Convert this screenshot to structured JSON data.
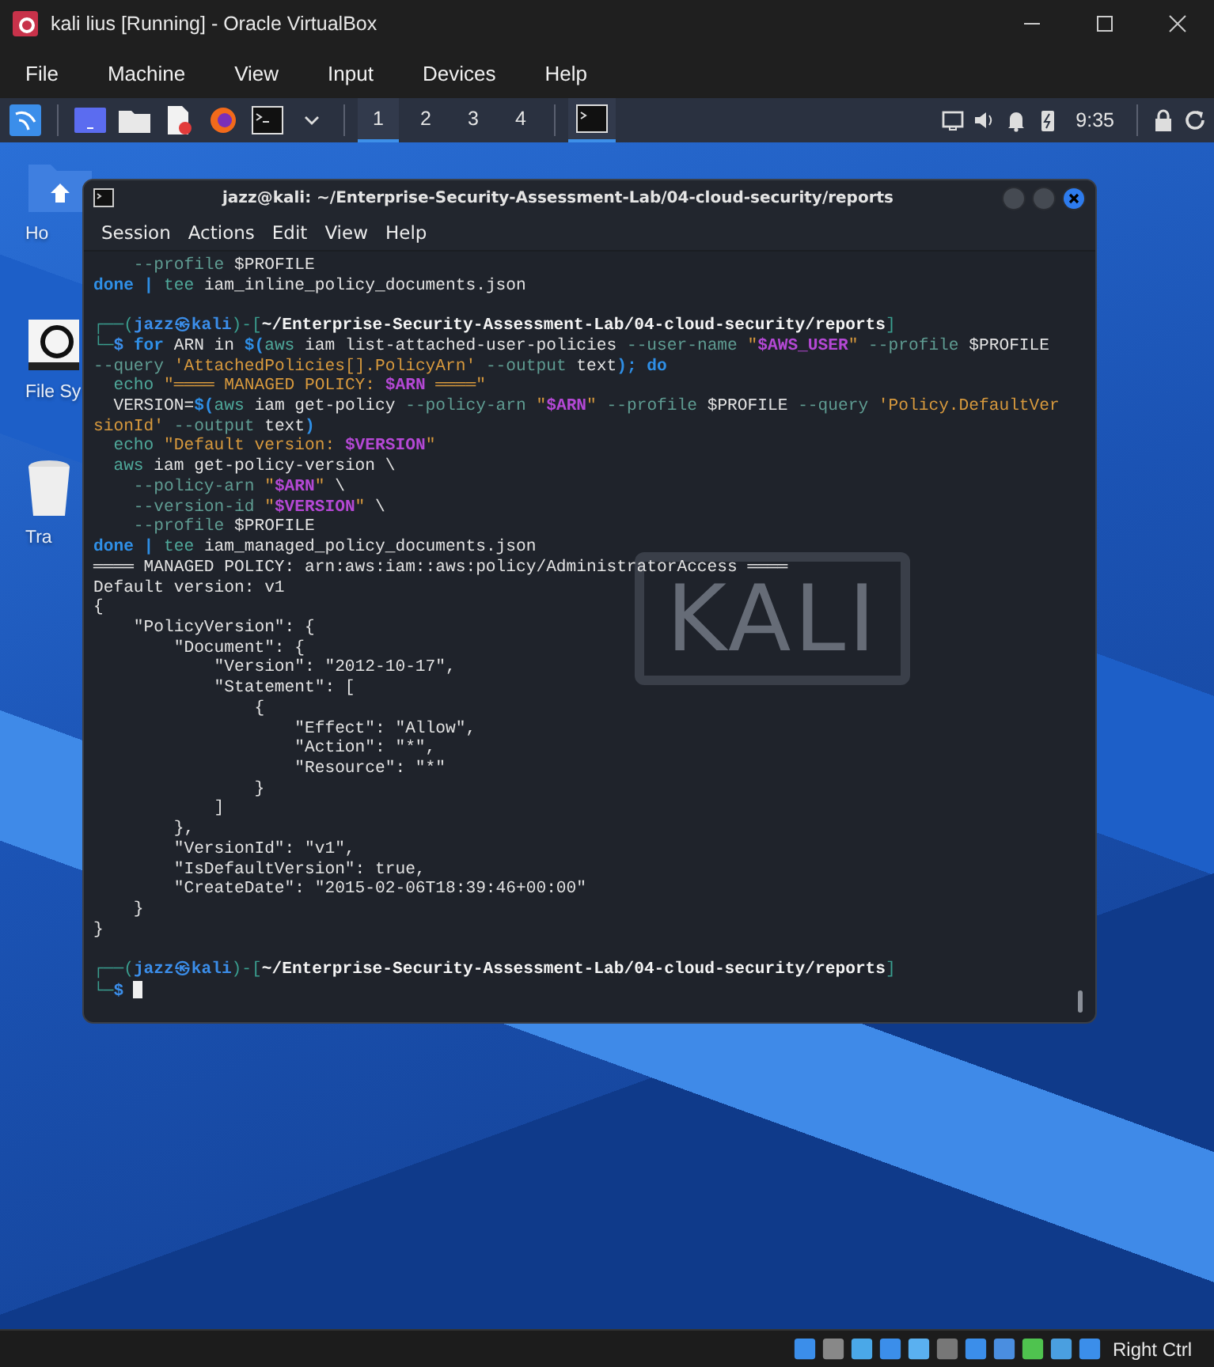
{
  "vm_window": {
    "title": "kali lius [Running] - Oracle VirtualBox",
    "menu": [
      "File",
      "Machine",
      "View",
      "Input",
      "Devices",
      "Help"
    ]
  },
  "panel": {
    "workspaces": [
      {
        "label": "1",
        "selected": true
      },
      {
        "label": "2",
        "selected": false
      },
      {
        "label": "3",
        "selected": false
      },
      {
        "label": "4",
        "selected": false
      }
    ],
    "clock": "9:35"
  },
  "desktop_icons": [
    {
      "label": "Ho",
      "kind": "home"
    },
    {
      "label": "File Sy",
      "kind": "drive"
    },
    {
      "label": "Tra",
      "kind": "trash"
    }
  ],
  "terminal": {
    "title": "jazz@kali: ~/Enterprise-Security-Assessment-Lab/04-cloud-security/reports",
    "menu": [
      "Session",
      "Actions",
      "Edit",
      "View",
      "Help"
    ],
    "background_logo": "KALI",
    "lines": [
      {
        "kind": "text",
        "segments": [
          {
            "text": "    --profile",
            "kind": "opt"
          },
          {
            "text": " $PROFILE",
            "kind": "plain"
          }
        ]
      },
      {
        "kind": "text",
        "segments": [
          {
            "text": "done | ",
            "kind": "kw"
          },
          {
            "text": "tee",
            "kind": "cmd"
          },
          {
            "text": " iam_inline_policy_documents.json",
            "kind": "plain"
          }
        ]
      },
      {
        "kind": "blank"
      },
      {
        "kind": "text",
        "segments": [
          {
            "text": "┌──(",
            "kind": "frame"
          },
          {
            "text": "jazz㉿kali",
            "kind": "user"
          },
          {
            "text": ")-[",
            "kind": "frame"
          },
          {
            "text": "~/Enterprise-Security-Assessment-Lab/04-cloud-security/reports",
            "kind": "path"
          },
          {
            "text": "]",
            "kind": "frame"
          }
        ]
      },
      {
        "kind": "text",
        "segments": [
          {
            "text": "└─",
            "kind": "frame"
          },
          {
            "text": "$ ",
            "kind": "user"
          },
          {
            "text": "for",
            "kind": "kw"
          },
          {
            "text": " ARN in ",
            "kind": "plain"
          },
          {
            "text": "$(",
            "kind": "kw"
          },
          {
            "text": "aws",
            "kind": "cmd"
          },
          {
            "text": " iam list-attached-user-policies ",
            "kind": "plain"
          },
          {
            "text": "--user-name",
            "kind": "opt"
          },
          {
            "text": " \"",
            "kind": "str"
          },
          {
            "text": "$AWS_USER",
            "kind": "var"
          },
          {
            "text": "\"",
            "kind": "str"
          },
          {
            "text": " --profile",
            "kind": "opt"
          },
          {
            "text": " $PROFILE",
            "kind": "plain"
          }
        ]
      },
      {
        "kind": "text",
        "segments": [
          {
            "text": "--query",
            "kind": "opt"
          },
          {
            "text": " 'AttachedPolicies[].PolicyArn'",
            "kind": "str"
          },
          {
            "text": " --output",
            "kind": "opt"
          },
          {
            "text": " text",
            "kind": "plain"
          },
          {
            "text": "); do",
            "kind": "kw"
          }
        ]
      },
      {
        "kind": "text",
        "segments": [
          {
            "text": "  echo",
            "kind": "cmd"
          },
          {
            "text": " \"════ MANAGED POLICY: ",
            "kind": "str"
          },
          {
            "text": "$ARN",
            "kind": "var"
          },
          {
            "text": " ════\"",
            "kind": "str"
          }
        ]
      },
      {
        "kind": "text",
        "segments": [
          {
            "text": "  VERSION=",
            "kind": "plain"
          },
          {
            "text": "$(",
            "kind": "kw"
          },
          {
            "text": "aws",
            "kind": "cmd"
          },
          {
            "text": " iam get-policy ",
            "kind": "plain"
          },
          {
            "text": "--policy-arn",
            "kind": "opt"
          },
          {
            "text": " \"",
            "kind": "str"
          },
          {
            "text": "$ARN",
            "kind": "var"
          },
          {
            "text": "\"",
            "kind": "str"
          },
          {
            "text": " --profile",
            "kind": "opt"
          },
          {
            "text": " $PROFILE ",
            "kind": "plain"
          },
          {
            "text": "--query",
            "kind": "opt"
          },
          {
            "text": " 'Policy.DefaultVer",
            "kind": "str"
          }
        ]
      },
      {
        "kind": "text",
        "segments": [
          {
            "text": "sionId'",
            "kind": "str"
          },
          {
            "text": " --output",
            "kind": "opt"
          },
          {
            "text": " text",
            "kind": "plain"
          },
          {
            "text": ")",
            "kind": "kw"
          }
        ]
      },
      {
        "kind": "text",
        "segments": [
          {
            "text": "  echo",
            "kind": "cmd"
          },
          {
            "text": " \"Default version: ",
            "kind": "str"
          },
          {
            "text": "$VERSION",
            "kind": "var"
          },
          {
            "text": "\"",
            "kind": "str"
          }
        ]
      },
      {
        "kind": "text",
        "segments": [
          {
            "text": "  aws",
            "kind": "cmd"
          },
          {
            "text": " iam get-policy-version \\",
            "kind": "plain"
          }
        ]
      },
      {
        "kind": "text",
        "segments": [
          {
            "text": "    --policy-arn",
            "kind": "opt"
          },
          {
            "text": " \"",
            "kind": "str"
          },
          {
            "text": "$ARN",
            "kind": "var"
          },
          {
            "text": "\"",
            "kind": "str"
          },
          {
            "text": " \\",
            "kind": "plain"
          }
        ]
      },
      {
        "kind": "text",
        "segments": [
          {
            "text": "    --version-id",
            "kind": "opt"
          },
          {
            "text": " \"",
            "kind": "str"
          },
          {
            "text": "$VERSION",
            "kind": "var"
          },
          {
            "text": "\"",
            "kind": "str"
          },
          {
            "text": " \\",
            "kind": "plain"
          }
        ]
      },
      {
        "kind": "text",
        "segments": [
          {
            "text": "    --profile",
            "kind": "opt"
          },
          {
            "text": " $PROFILE",
            "kind": "plain"
          }
        ]
      },
      {
        "kind": "text",
        "segments": [
          {
            "text": "done | ",
            "kind": "kw"
          },
          {
            "text": "tee",
            "kind": "cmd"
          },
          {
            "text": " iam_managed_policy_documents.json",
            "kind": "plain"
          }
        ]
      },
      {
        "kind": "text",
        "segments": [
          {
            "text": "════ MANAGED POLICY: arn:aws:iam::aws:policy/AdministratorAccess ════",
            "kind": "plain"
          }
        ]
      },
      {
        "kind": "text",
        "segments": [
          {
            "text": "Default version: v1",
            "kind": "plain"
          }
        ]
      },
      {
        "kind": "text",
        "segments": [
          {
            "text": "{",
            "kind": "plain"
          }
        ]
      },
      {
        "kind": "text",
        "segments": [
          {
            "text": "    \"PolicyVersion\": {",
            "kind": "plain"
          }
        ]
      },
      {
        "kind": "text",
        "segments": [
          {
            "text": "        \"Document\": {",
            "kind": "plain"
          }
        ]
      },
      {
        "kind": "text",
        "segments": [
          {
            "text": "            \"Version\": \"2012-10-17\",",
            "kind": "plain"
          }
        ]
      },
      {
        "kind": "text",
        "segments": [
          {
            "text": "            \"Statement\": [",
            "kind": "plain"
          }
        ]
      },
      {
        "kind": "text",
        "segments": [
          {
            "text": "                {",
            "kind": "plain"
          }
        ]
      },
      {
        "kind": "text",
        "segments": [
          {
            "text": "                    \"Effect\": \"Allow\",",
            "kind": "plain"
          }
        ]
      },
      {
        "kind": "text",
        "segments": [
          {
            "text": "                    \"Action\": \"*\",",
            "kind": "plain"
          }
        ]
      },
      {
        "kind": "text",
        "segments": [
          {
            "text": "                    \"Resource\": \"*\"",
            "kind": "plain"
          }
        ]
      },
      {
        "kind": "text",
        "segments": [
          {
            "text": "                }",
            "kind": "plain"
          }
        ]
      },
      {
        "kind": "text",
        "segments": [
          {
            "text": "            ]",
            "kind": "plain"
          }
        ]
      },
      {
        "kind": "text",
        "segments": [
          {
            "text": "        },",
            "kind": "plain"
          }
        ]
      },
      {
        "kind": "text",
        "segments": [
          {
            "text": "        \"VersionId\": \"v1\",",
            "kind": "plain"
          }
        ]
      },
      {
        "kind": "text",
        "segments": [
          {
            "text": "        \"IsDefaultVersion\": true,",
            "kind": "plain"
          }
        ]
      },
      {
        "kind": "text",
        "segments": [
          {
            "text": "        \"CreateDate\": \"2015-02-06T18:39:46+00:00\"",
            "kind": "plain"
          }
        ]
      },
      {
        "kind": "text",
        "segments": [
          {
            "text": "    }",
            "kind": "plain"
          }
        ]
      },
      {
        "kind": "text",
        "segments": [
          {
            "text": "}",
            "kind": "plain"
          }
        ]
      },
      {
        "kind": "blank"
      },
      {
        "kind": "text",
        "segments": [
          {
            "text": "┌──(",
            "kind": "frame"
          },
          {
            "text": "jazz㉿kali",
            "kind": "user"
          },
          {
            "text": ")-[",
            "kind": "frame"
          },
          {
            "text": "~/Enterprise-Security-Assessment-Lab/04-cloud-security/reports",
            "kind": "path"
          },
          {
            "text": "]",
            "kind": "frame"
          }
        ]
      },
      {
        "kind": "input",
        "segments": [
          {
            "text": "└─",
            "kind": "frame"
          },
          {
            "text": "$",
            "kind": "user"
          }
        ]
      }
    ]
  },
  "status_bar": {
    "host_key": "Right Ctrl"
  }
}
